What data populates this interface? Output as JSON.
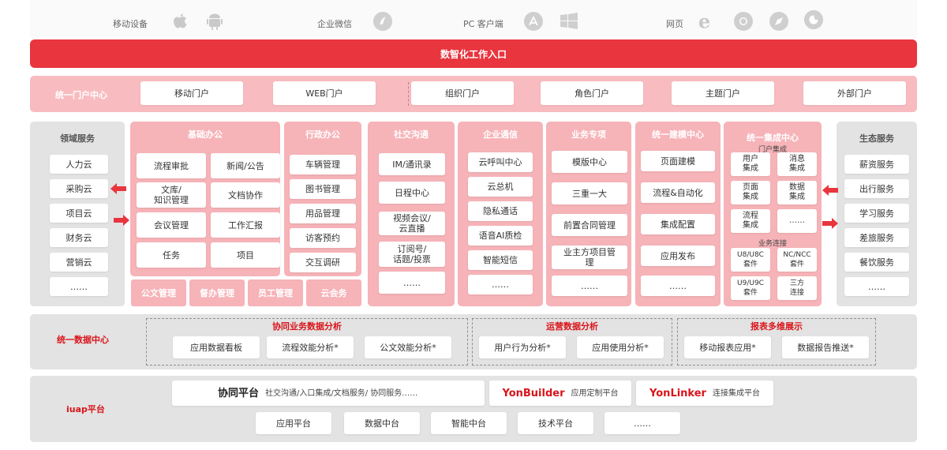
{
  "top": {
    "mobile": "移动设备",
    "wechat": "企业微信",
    "pc": "PC 客户端",
    "web": "网页"
  },
  "entry": "数智化工作入口",
  "portal": {
    "label": "统一门户中心",
    "items": [
      "移动门户",
      "WEB门户",
      "组织门户",
      "角色门户",
      "主题门户",
      "外部门户"
    ]
  },
  "domain": {
    "title": "领域服务",
    "items": [
      "人力云",
      "采购云",
      "项目云",
      "财务云",
      "营销云",
      "……"
    ]
  },
  "basic": {
    "title": "基础办公",
    "items": [
      "流程审批",
      "新闻/公告",
      "文库/\n知识管理",
      "文档协作",
      "会议管理",
      "工作汇报",
      "任务",
      "项目"
    ]
  },
  "bottomStrip": [
    "公文管理",
    "督办管理",
    "员工管理",
    "云会务"
  ],
  "admin": {
    "title": "行政办公",
    "items": [
      "车辆管理",
      "图书管理",
      "用品管理",
      "访客预约",
      "交互调研"
    ]
  },
  "social": {
    "title": "社交沟通",
    "items": [
      "IM/通讯录",
      "日程中心",
      "视频会议/\n云直播",
      "订阅号/\n话题/投票",
      "……"
    ]
  },
  "comm": {
    "title": "企业通信",
    "items": [
      "云呼叫中心",
      "云总机",
      "隐私通话",
      "语音AI质检",
      "智能短信",
      "……"
    ]
  },
  "biz": {
    "title": "业务专项",
    "items": [
      "模版中心",
      "三重一大",
      "前置合同管理",
      "业主方项目管\n理",
      "……"
    ]
  },
  "lowcode": {
    "title": "统一建模中心",
    "items": [
      "页面建模",
      "流程&自动化",
      "集成配置",
      "应用发布",
      "……"
    ]
  },
  "integ": {
    "title": "统一集成中心",
    "sub1": "门户集成",
    "items1": [
      "用户\n集成",
      "消息\n集成",
      "页面\n集成",
      "数据\n集成",
      "流程\n集成",
      "……"
    ],
    "sub2": "业务连接",
    "items2": [
      "U8/U8C\n套件",
      "NC/NCC\n套件",
      "U9/U9C\n套件",
      "三方\n连接"
    ]
  },
  "eco": {
    "title": "生态服务",
    "items": [
      "薪资服务",
      "出行服务",
      "学习服务",
      "差旅服务",
      "餐饮服务",
      "……"
    ]
  },
  "data": {
    "label": "统一数据中心",
    "g1": {
      "title": "协同业务数据分析",
      "items": [
        "应用数据看板",
        "流程效能分析*",
        "公文效能分析*"
      ]
    },
    "g2": {
      "title": "运营数据分析",
      "items": [
        "用户行为分析*",
        "应用使用分析*"
      ]
    },
    "g3": {
      "title": "报表多维展示",
      "items": [
        "移动报表应用*",
        "数据报告推送*"
      ]
    }
  },
  "iuap": {
    "label": "iuap平台",
    "collab_title": "协同平台",
    "collab_desc": "社交沟通/入口集成/文档服务/ 协同服务……",
    "yb_logo": "YonBuilder",
    "yb_desc": "应用定制平台",
    "yl_logo": "YonLinker",
    "yl_desc": "连接集成平台",
    "items": [
      "应用平台",
      "数据中台",
      "智能中台",
      "技术平台",
      "……"
    ]
  },
  "colors": {
    "accent": "#e8353e",
    "pink": "#f6b3b8",
    "gray": "#e3e3e3",
    "label": "#d9141a"
  }
}
